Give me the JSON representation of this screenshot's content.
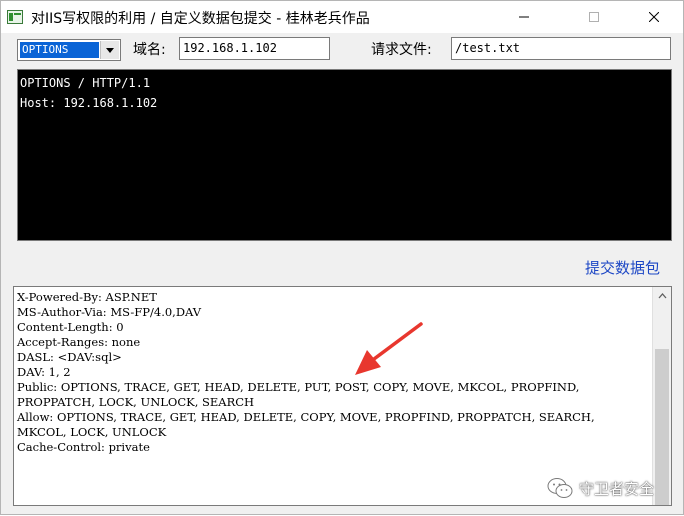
{
  "window": {
    "title": "对IIS写权限的利用 / 自定义数据包提交 - 桂林老兵作品"
  },
  "toolbar": {
    "method": "OPTIONS",
    "domain_label": "域名:",
    "domain_value": "192.168.1.102",
    "file_label": "请求文件:",
    "file_value": "/test.txt"
  },
  "request": {
    "lines": [
      "OPTIONS / HTTP/1.1",
      "Host: 192.168.1.102"
    ]
  },
  "submit_label": "提交数据包",
  "response": {
    "lines": [
      "X-Powered-By: ASP.NET",
      "MS-Author-Via: MS-FP/4.0,DAV",
      "Content-Length: 0",
      "Accept-Ranges: none",
      "DASL: <DAV:sql>",
      "DAV: 1, 2",
      "Public: OPTIONS, TRACE, GET, HEAD, DELETE, PUT, POST, COPY, MOVE, MKCOL, PROPFIND,",
      "PROPPATCH, LOCK, UNLOCK, SEARCH",
      "Allow: OPTIONS, TRACE, GET, HEAD, DELETE, COPY, MOVE, PROPFIND, PROPPATCH, SEARCH,",
      "MKCOL, LOCK, UNLOCK",
      "Cache-Control: private"
    ]
  },
  "watermark": {
    "text": "守卫者安全",
    "icon": "wechat-icon"
  },
  "colors": {
    "accent": "#0a64d6",
    "link": "#1d47c5",
    "annotation_arrow": "#e8372e"
  }
}
